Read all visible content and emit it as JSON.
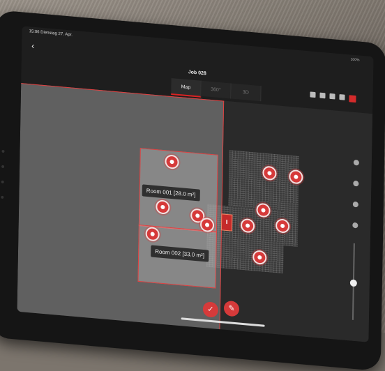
{
  "status": {
    "time_date": "15:06   Dienstag 27. Apr.",
    "battery": "100%"
  },
  "header": {
    "back_glyph": "‹",
    "title": "Job 028"
  },
  "tabs": [
    {
      "label": "Map",
      "active": true
    },
    {
      "label": "360°",
      "active": false
    },
    {
      "label": "3D",
      "active": false
    }
  ],
  "rooms": [
    {
      "label": "Room 001 [28.0 m²]"
    },
    {
      "label": "Room 002 [33.0 m²]"
    }
  ],
  "center_handle": "‖",
  "fabs": {
    "mark": "✓",
    "edit": "✎"
  },
  "colors": {
    "accent": "#d63a3a",
    "panel": "#8c8c8c",
    "background": "#1e1e1e"
  },
  "icons": [
    "back-icon",
    "layers-icon",
    "camera-icon",
    "battery-icon",
    "gear-icon",
    "record-icon",
    "home-icon",
    "refresh-icon",
    "plus-icon",
    "target-icon",
    "check-icon",
    "pencil-icon"
  ]
}
